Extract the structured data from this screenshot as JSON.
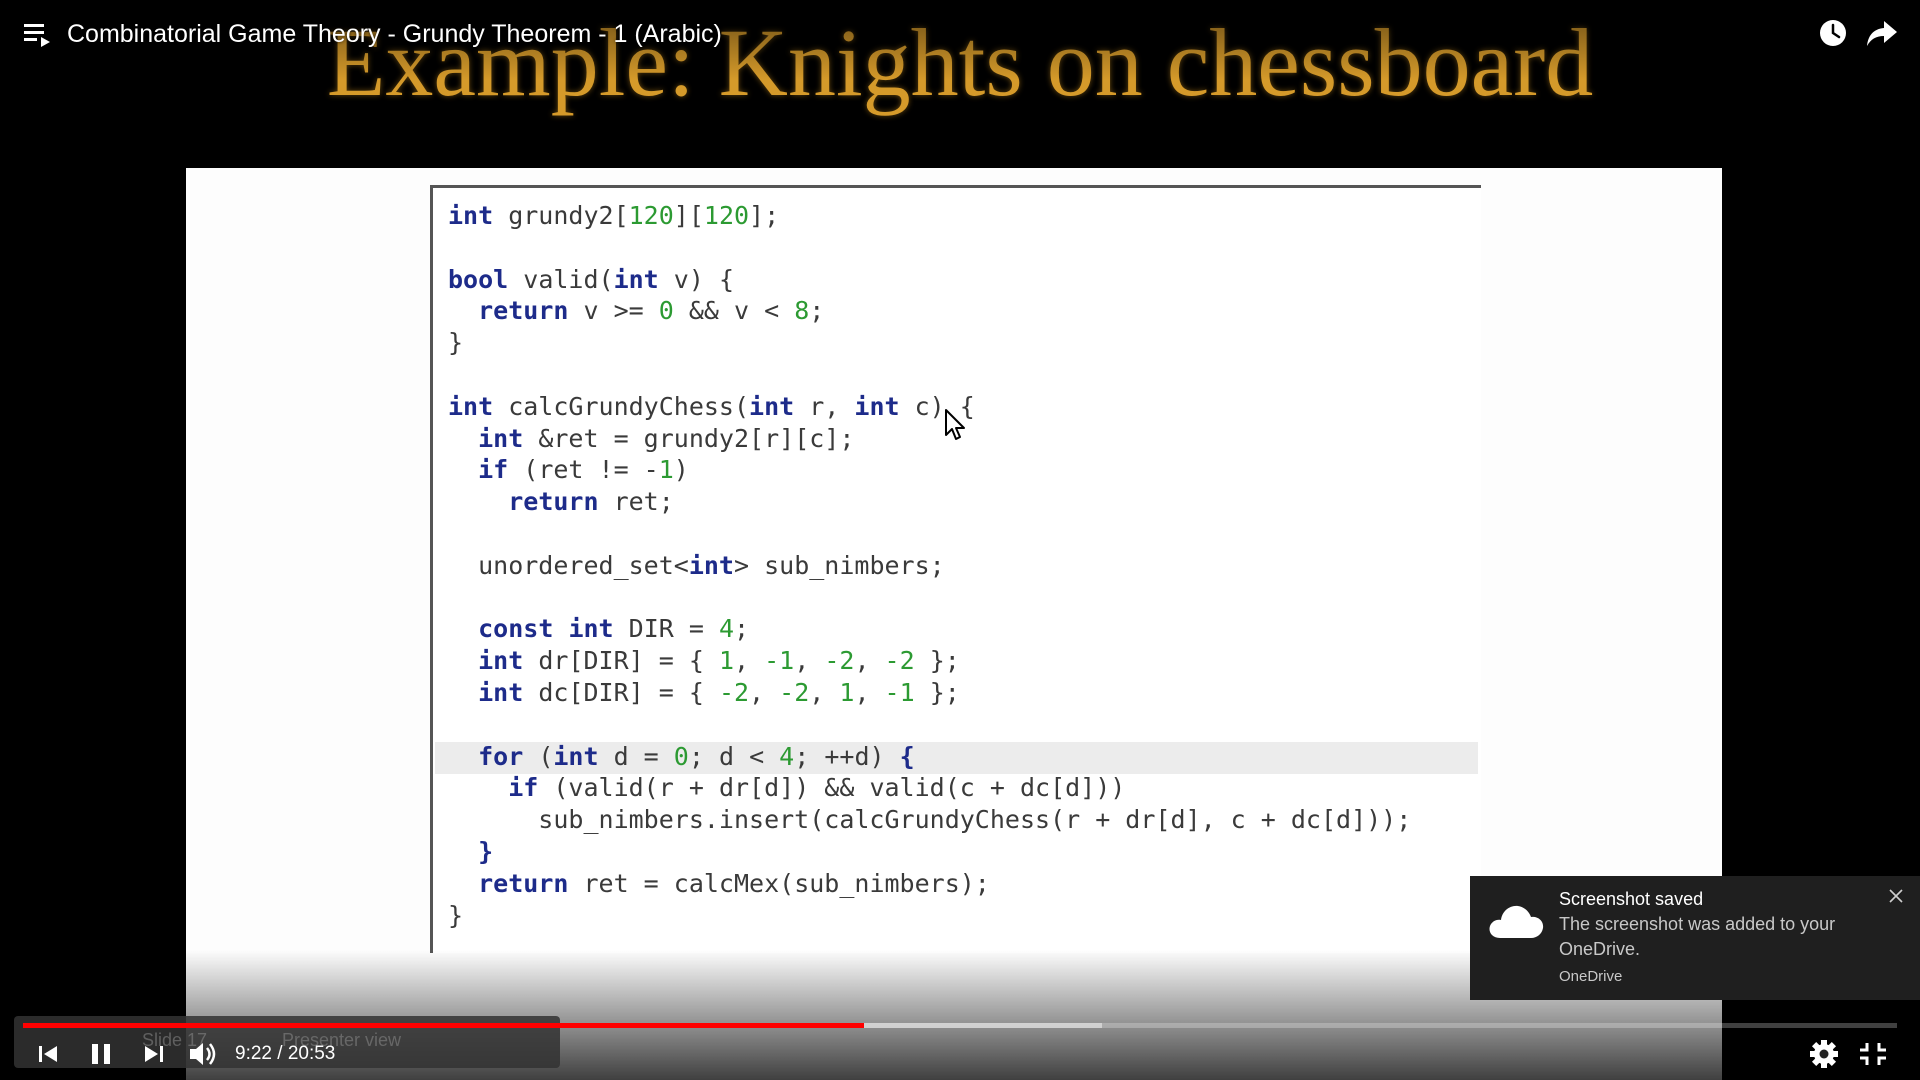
{
  "video": {
    "title": "Combinatorial Game Theory - Grundy Theorem - 1 (Arabic)",
    "time_current": "9:22",
    "time_separator": " / ",
    "time_total": "20:53",
    "played_fraction": 0.449,
    "buffered_fraction": 0.576
  },
  "slide": {
    "title": "Example: Knights on chessboard",
    "code_lines": [
      [
        {
          "t": "int",
          "c": "kw"
        },
        {
          "t": " grundy2["
        },
        {
          "t": "120",
          "c": "num"
        },
        {
          "t": "]["
        },
        {
          "t": "120",
          "c": "num"
        },
        {
          "t": "];"
        }
      ],
      [],
      [
        {
          "t": "bool",
          "c": "kw"
        },
        {
          "t": " valid("
        },
        {
          "t": "int",
          "c": "kw"
        },
        {
          "t": " v) {"
        }
      ],
      [
        {
          "t": "  "
        },
        {
          "t": "return",
          "c": "kw"
        },
        {
          "t": " v >= "
        },
        {
          "t": "0",
          "c": "num"
        },
        {
          "t": " && v < "
        },
        {
          "t": "8",
          "c": "num"
        },
        {
          "t": ";"
        }
      ],
      [
        {
          "t": "}"
        }
      ],
      [],
      [
        {
          "t": "int",
          "c": "kw"
        },
        {
          "t": " calcGrundyChess("
        },
        {
          "t": "int",
          "c": "kw"
        },
        {
          "t": " r, "
        },
        {
          "t": "int",
          "c": "kw"
        },
        {
          "t": " c) {"
        }
      ],
      [
        {
          "t": "  "
        },
        {
          "t": "int",
          "c": "kw"
        },
        {
          "t": " &ret = grundy2[r][c];"
        }
      ],
      [
        {
          "t": "  "
        },
        {
          "t": "if",
          "c": "kw"
        },
        {
          "t": " (ret != -"
        },
        {
          "t": "1",
          "c": "num"
        },
        {
          "t": ")"
        }
      ],
      [
        {
          "t": "    "
        },
        {
          "t": "return",
          "c": "kw"
        },
        {
          "t": " ret;"
        }
      ],
      [],
      [
        {
          "t": "  unordered_set<"
        },
        {
          "t": "int",
          "c": "kw"
        },
        {
          "t": "> sub_nimbers;"
        }
      ],
      [],
      [
        {
          "t": "  "
        },
        {
          "t": "const",
          "c": "kw"
        },
        {
          "t": " "
        },
        {
          "t": "int",
          "c": "kw"
        },
        {
          "t": " DIR = "
        },
        {
          "t": "4",
          "c": "num"
        },
        {
          "t": ";"
        }
      ],
      [
        {
          "t": "  "
        },
        {
          "t": "int",
          "c": "kw"
        },
        {
          "t": " dr[DIR] = { "
        },
        {
          "t": "1",
          "c": "num"
        },
        {
          "t": ", "
        },
        {
          "t": "-1",
          "c": "num"
        },
        {
          "t": ", "
        },
        {
          "t": "-2",
          "c": "num"
        },
        {
          "t": ", "
        },
        {
          "t": "-2",
          "c": "num"
        },
        {
          "t": " };"
        }
      ],
      [
        {
          "t": "  "
        },
        {
          "t": "int",
          "c": "kw"
        },
        {
          "t": " dc[DIR] = { "
        },
        {
          "t": "-2",
          "c": "num"
        },
        {
          "t": ", "
        },
        {
          "t": "-2",
          "c": "num"
        },
        {
          "t": ", "
        },
        {
          "t": "1",
          "c": "num"
        },
        {
          "t": ", "
        },
        {
          "t": "-1",
          "c": "num"
        },
        {
          "t": " };"
        }
      ],
      [],
      [
        {
          "t": "  "
        },
        {
          "t": "for",
          "c": "kw"
        },
        {
          "t": " ("
        },
        {
          "t": "int",
          "c": "kw"
        },
        {
          "t": " d = "
        },
        {
          "t": "0",
          "c": "num"
        },
        {
          "t": "; d < "
        },
        {
          "t": "4",
          "c": "num"
        },
        {
          "t": "; ++d) "
        },
        {
          "t": "{",
          "c": "kw"
        }
      ],
      [
        {
          "t": "    "
        },
        {
          "t": "if",
          "c": "kw"
        },
        {
          "t": " (valid(r + dr[d]) && valid(c + dc[d]))"
        }
      ],
      [
        {
          "t": "      sub_nimbers.insert(calcGrundyChess(r + dr[d], c + dc[d]));"
        }
      ],
      [
        {
          "t": "  "
        },
        {
          "t": "}",
          "c": "kw"
        }
      ],
      [
        {
          "t": "  "
        },
        {
          "t": "return",
          "c": "kw"
        },
        {
          "t": " ret = calcMex(sub_nimbers);"
        }
      ],
      [
        {
          "t": "}"
        }
      ]
    ]
  },
  "ghost_toolbar": {
    "slide_label": "Slide 17",
    "presenter_label": "Presenter view"
  },
  "toast": {
    "title": "Screenshot saved",
    "body": "The screenshot was added to your OneDrive.",
    "source": "OneDrive"
  },
  "icons": {
    "playlist": "playlist-icon",
    "watch_later": "clock-icon",
    "share": "share-arrow-icon",
    "previous": "skip-previous-icon",
    "pause": "pause-icon",
    "next": "skip-next-icon",
    "volume": "volume-icon",
    "settings": "gear-icon",
    "exit_fullscreen": "exit-fullscreen-icon",
    "toast_cloud": "cloud-icon",
    "toast_close": "close-icon"
  },
  "colors": {
    "progress_played": "#ff0000",
    "slide_title": "#d59a2a",
    "code_keyword": "#1d2b8a",
    "code_number": "#2c9a32"
  }
}
